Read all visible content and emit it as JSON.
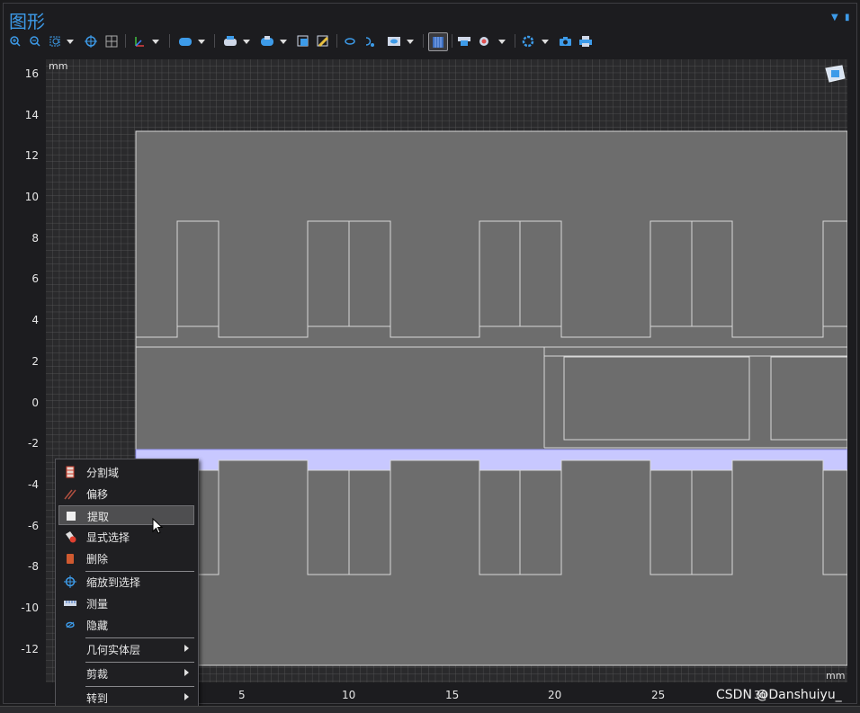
{
  "window": {
    "title": "图形"
  },
  "toolbar": {
    "icons": [
      "zoom-in-icon",
      "zoom-out-icon",
      "zoom-box-icon",
      "zoom-extents-icon",
      "zoom-selected-icon",
      "axes-icon",
      "select-object-icon",
      "select-box-icon",
      "select-domain-icon",
      "clear-selection-icon",
      "hide-icon",
      "show-icon",
      "scene-light-icon",
      "wireframe-icon",
      "transparency-icon",
      "views-icon",
      "settings-icon",
      "camera-icon",
      "print-icon"
    ]
  },
  "plot": {
    "unit_y": "mm",
    "unit_x": "mm",
    "y_ticks": [
      "16",
      "14",
      "12",
      "10",
      "8",
      "6",
      "4",
      "2",
      "0",
      "-2",
      "-4",
      "-6",
      "-8",
      "-10",
      "-12"
    ],
    "x_ticks": [
      "5",
      "10",
      "15",
      "20",
      "25",
      "30"
    ],
    "colors": {
      "background": "#2a2a2c",
      "grid": "#6a6a6c",
      "domain": "#6d6d6d",
      "edge": "#d8d8d8",
      "selection": "#c8c8ff"
    }
  },
  "context_menu": {
    "items": [
      {
        "label": "分割域",
        "icon": "partition-domains-icon"
      },
      {
        "label": "偏移",
        "icon": "offset-icon"
      },
      {
        "label": "提取",
        "icon": "extract-icon",
        "highlighted": true
      },
      {
        "label": "显式选择",
        "icon": "explicit-selection-icon"
      },
      {
        "label": "删除",
        "icon": "delete-icon"
      },
      {
        "label": "缩放到选择",
        "icon": "zoom-to-selection-icon"
      },
      {
        "label": "测量",
        "icon": "measure-icon"
      },
      {
        "label": "隐藏",
        "icon": "hide-icon"
      },
      {
        "label": "几何实体层",
        "submenu": true
      },
      {
        "label": "剪裁",
        "submenu": true
      },
      {
        "label": "转到",
        "submenu": true
      }
    ]
  },
  "watermark": "CSDN @Danshuiyu_"
}
